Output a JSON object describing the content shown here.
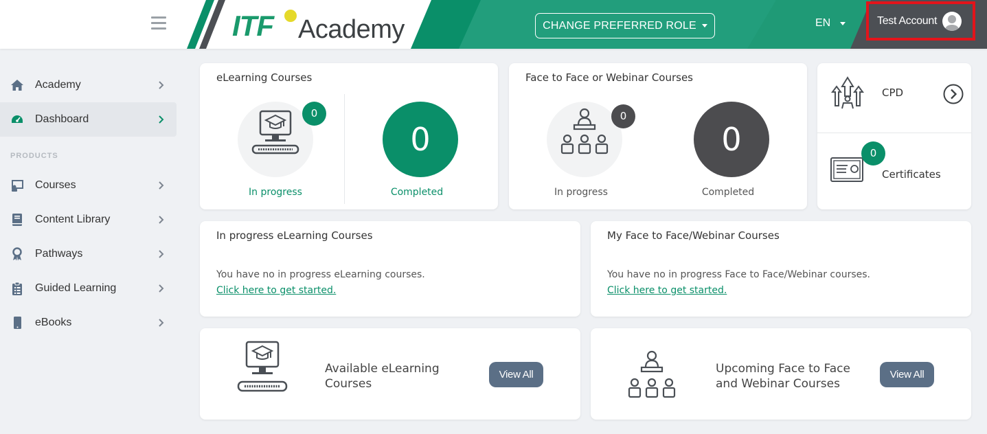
{
  "header": {
    "logo_itf": "ITF",
    "logo_academy": "Academy",
    "role_button": "CHANGE PREFERRED ROLE",
    "language": "EN",
    "account_name": "Test Account",
    "colors": {
      "brand_green": "#0a8f69",
      "dark_gray": "#4c4c4f",
      "highlight": "#e3141b"
    }
  },
  "sidebar": {
    "items": [
      {
        "label": "Academy",
        "icon": "home-icon"
      },
      {
        "label": "Dashboard",
        "icon": "dashboard-icon",
        "active": true
      }
    ],
    "section": "PRODUCTS",
    "products": [
      {
        "label": "Courses",
        "icon": "courses-icon"
      },
      {
        "label": "Content Library",
        "icon": "book-icon"
      },
      {
        "label": "Pathways",
        "icon": "pathways-icon"
      },
      {
        "label": "Guided Learning",
        "icon": "clipboard-icon"
      },
      {
        "label": "eBooks",
        "icon": "ebook-icon"
      }
    ]
  },
  "elearning": {
    "title": "eLearning Courses",
    "in_progress_count": "0",
    "in_progress_label": "In progress",
    "completed_count": "0",
    "completed_label": "Completed"
  },
  "f2f": {
    "title": "Face to Face or Webinar Courses",
    "in_progress_count": "0",
    "in_progress_label": "In progress",
    "completed_count": "0",
    "completed_label": "Completed"
  },
  "side_cards": {
    "cpd_label": "CPD",
    "certificates_label": "Certificates",
    "certificates_count": "0"
  },
  "in_progress_elearning": {
    "title": "In progress eLearning Courses",
    "empty_text": "You have no in progress eLearning courses.",
    "link": "Click here to get started."
  },
  "my_f2f": {
    "title": "My Face to Face/Webinar Courses",
    "empty_text": "You have no in progress Face to Face/Webinar courses.",
    "link": "Click here to get started."
  },
  "promo_elearning": {
    "title_line1": "Available eLearning",
    "title_line2": "Courses",
    "button": "View All"
  },
  "promo_f2f": {
    "title_line1": "Upcoming Face to Face",
    "title_line2": "and Webinar Courses",
    "button": "View All"
  }
}
